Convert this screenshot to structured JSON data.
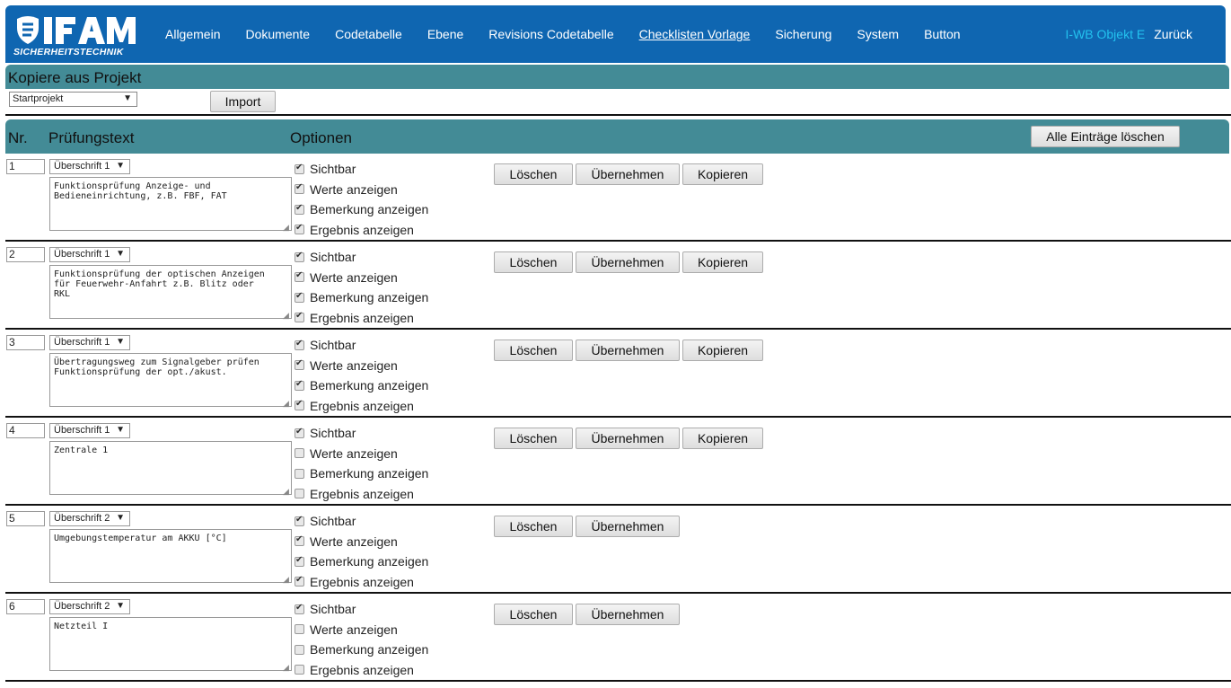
{
  "logo": {
    "text": "IFAM",
    "subtext": "SICHERHEITSTECHNIK"
  },
  "nav": {
    "items": [
      "Allgemein",
      "Dokumente",
      "Codetabelle",
      "Ebene",
      "Revisions Codetabelle",
      "Checklisten Vorlage",
      "Sicherung",
      "System",
      "Button"
    ],
    "active": "Checklisten Vorlage",
    "user": "I-WB Objekt E",
    "back": "Zurück"
  },
  "copy": {
    "title": "Kopiere aus Projekt",
    "project_select": "Startprojekt",
    "import_label": "Import"
  },
  "table_header": {
    "nr": "Nr.",
    "text": "Prüfungstext",
    "options": "Optionen",
    "clear_all": "Alle Einträge löschen"
  },
  "option_labels": [
    "Sichtbar",
    "Werte anzeigen",
    "Bemerkung anzeigen",
    "Ergebnis anzeigen"
  ],
  "buttons": {
    "delete": "Löschen",
    "apply": "Übernehmen",
    "copy": "Kopieren"
  },
  "entries": [
    {
      "nr": "1",
      "heading": "Überschrift 1",
      "text": "Funktionsprüfung Anzeige- und\nBedieneinrichtung, z.B. FBF, FAT",
      "options": [
        true,
        true,
        true,
        true
      ],
      "copy": true
    },
    {
      "nr": "2",
      "heading": "Überschrift 1",
      "text": "Funktionsprüfung der optischen Anzeigen\nfür Feuerwehr-Anfahrt z.B. Blitz oder\nRKL",
      "options": [
        true,
        true,
        true,
        true
      ],
      "copy": true
    },
    {
      "nr": "3",
      "heading": "Überschrift 1",
      "text": "Übertragungsweg zum Signalgeber prüfen\nFunktionsprüfung der opt./akust.",
      "options": [
        true,
        true,
        true,
        true
      ],
      "copy": true
    },
    {
      "nr": "4",
      "heading": "Überschrift 1",
      "text": "Zentrale 1",
      "options": [
        true,
        false,
        false,
        false
      ],
      "copy": true
    },
    {
      "nr": "5",
      "heading": "Überschrift 2",
      "text": "Umgebungstemperatur am AKKU [°C]",
      "options": [
        true,
        true,
        true,
        true
      ],
      "copy": false
    },
    {
      "nr": "6",
      "heading": "Überschrift 2",
      "text": "Netzteil I",
      "options": [
        true,
        false,
        false,
        false
      ],
      "copy": false
    }
  ],
  "colors": {
    "nav_bg": "#0f66b1",
    "section_bar": "#438b96",
    "user_text": "#23c2ef"
  },
  "icons": {
    "resize_grip": "resize-grip-icon",
    "dropdown": "chevron-down-icon",
    "checkbox": "check-icon"
  }
}
